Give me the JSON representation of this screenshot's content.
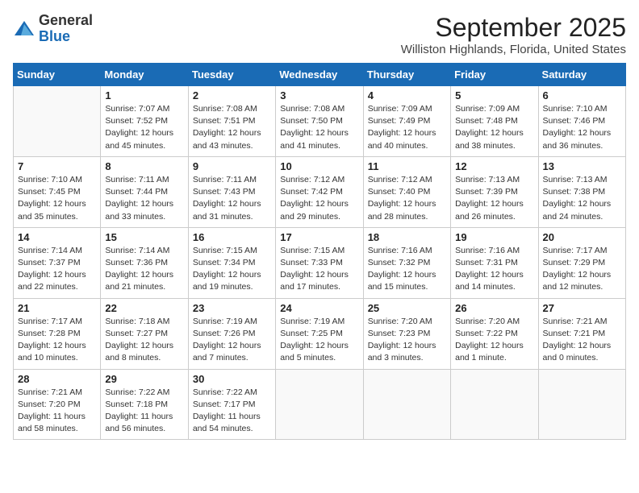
{
  "header": {
    "logo_general": "General",
    "logo_blue": "Blue",
    "month_title": "September 2025",
    "subtitle": "Williston Highlands, Florida, United States"
  },
  "weekdays": [
    "Sunday",
    "Monday",
    "Tuesday",
    "Wednesday",
    "Thursday",
    "Friday",
    "Saturday"
  ],
  "weeks": [
    [
      {
        "day": "",
        "info": ""
      },
      {
        "day": "1",
        "info": "Sunrise: 7:07 AM\nSunset: 7:52 PM\nDaylight: 12 hours\nand 45 minutes."
      },
      {
        "day": "2",
        "info": "Sunrise: 7:08 AM\nSunset: 7:51 PM\nDaylight: 12 hours\nand 43 minutes."
      },
      {
        "day": "3",
        "info": "Sunrise: 7:08 AM\nSunset: 7:50 PM\nDaylight: 12 hours\nand 41 minutes."
      },
      {
        "day": "4",
        "info": "Sunrise: 7:09 AM\nSunset: 7:49 PM\nDaylight: 12 hours\nand 40 minutes."
      },
      {
        "day": "5",
        "info": "Sunrise: 7:09 AM\nSunset: 7:48 PM\nDaylight: 12 hours\nand 38 minutes."
      },
      {
        "day": "6",
        "info": "Sunrise: 7:10 AM\nSunset: 7:46 PM\nDaylight: 12 hours\nand 36 minutes."
      }
    ],
    [
      {
        "day": "7",
        "info": "Sunrise: 7:10 AM\nSunset: 7:45 PM\nDaylight: 12 hours\nand 35 minutes."
      },
      {
        "day": "8",
        "info": "Sunrise: 7:11 AM\nSunset: 7:44 PM\nDaylight: 12 hours\nand 33 minutes."
      },
      {
        "day": "9",
        "info": "Sunrise: 7:11 AM\nSunset: 7:43 PM\nDaylight: 12 hours\nand 31 minutes."
      },
      {
        "day": "10",
        "info": "Sunrise: 7:12 AM\nSunset: 7:42 PM\nDaylight: 12 hours\nand 29 minutes."
      },
      {
        "day": "11",
        "info": "Sunrise: 7:12 AM\nSunset: 7:40 PM\nDaylight: 12 hours\nand 28 minutes."
      },
      {
        "day": "12",
        "info": "Sunrise: 7:13 AM\nSunset: 7:39 PM\nDaylight: 12 hours\nand 26 minutes."
      },
      {
        "day": "13",
        "info": "Sunrise: 7:13 AM\nSunset: 7:38 PM\nDaylight: 12 hours\nand 24 minutes."
      }
    ],
    [
      {
        "day": "14",
        "info": "Sunrise: 7:14 AM\nSunset: 7:37 PM\nDaylight: 12 hours\nand 22 minutes."
      },
      {
        "day": "15",
        "info": "Sunrise: 7:14 AM\nSunset: 7:36 PM\nDaylight: 12 hours\nand 21 minutes."
      },
      {
        "day": "16",
        "info": "Sunrise: 7:15 AM\nSunset: 7:34 PM\nDaylight: 12 hours\nand 19 minutes."
      },
      {
        "day": "17",
        "info": "Sunrise: 7:15 AM\nSunset: 7:33 PM\nDaylight: 12 hours\nand 17 minutes."
      },
      {
        "day": "18",
        "info": "Sunrise: 7:16 AM\nSunset: 7:32 PM\nDaylight: 12 hours\nand 15 minutes."
      },
      {
        "day": "19",
        "info": "Sunrise: 7:16 AM\nSunset: 7:31 PM\nDaylight: 12 hours\nand 14 minutes."
      },
      {
        "day": "20",
        "info": "Sunrise: 7:17 AM\nSunset: 7:29 PM\nDaylight: 12 hours\nand 12 minutes."
      }
    ],
    [
      {
        "day": "21",
        "info": "Sunrise: 7:17 AM\nSunset: 7:28 PM\nDaylight: 12 hours\nand 10 minutes."
      },
      {
        "day": "22",
        "info": "Sunrise: 7:18 AM\nSunset: 7:27 PM\nDaylight: 12 hours\nand 8 minutes."
      },
      {
        "day": "23",
        "info": "Sunrise: 7:19 AM\nSunset: 7:26 PM\nDaylight: 12 hours\nand 7 minutes."
      },
      {
        "day": "24",
        "info": "Sunrise: 7:19 AM\nSunset: 7:25 PM\nDaylight: 12 hours\nand 5 minutes."
      },
      {
        "day": "25",
        "info": "Sunrise: 7:20 AM\nSunset: 7:23 PM\nDaylight: 12 hours\nand 3 minutes."
      },
      {
        "day": "26",
        "info": "Sunrise: 7:20 AM\nSunset: 7:22 PM\nDaylight: 12 hours\nand 1 minute."
      },
      {
        "day": "27",
        "info": "Sunrise: 7:21 AM\nSunset: 7:21 PM\nDaylight: 12 hours\nand 0 minutes."
      }
    ],
    [
      {
        "day": "28",
        "info": "Sunrise: 7:21 AM\nSunset: 7:20 PM\nDaylight: 11 hours\nand 58 minutes."
      },
      {
        "day": "29",
        "info": "Sunrise: 7:22 AM\nSunset: 7:18 PM\nDaylight: 11 hours\nand 56 minutes."
      },
      {
        "day": "30",
        "info": "Sunrise: 7:22 AM\nSunset: 7:17 PM\nDaylight: 11 hours\nand 54 minutes."
      },
      {
        "day": "",
        "info": ""
      },
      {
        "day": "",
        "info": ""
      },
      {
        "day": "",
        "info": ""
      },
      {
        "day": "",
        "info": ""
      }
    ]
  ]
}
